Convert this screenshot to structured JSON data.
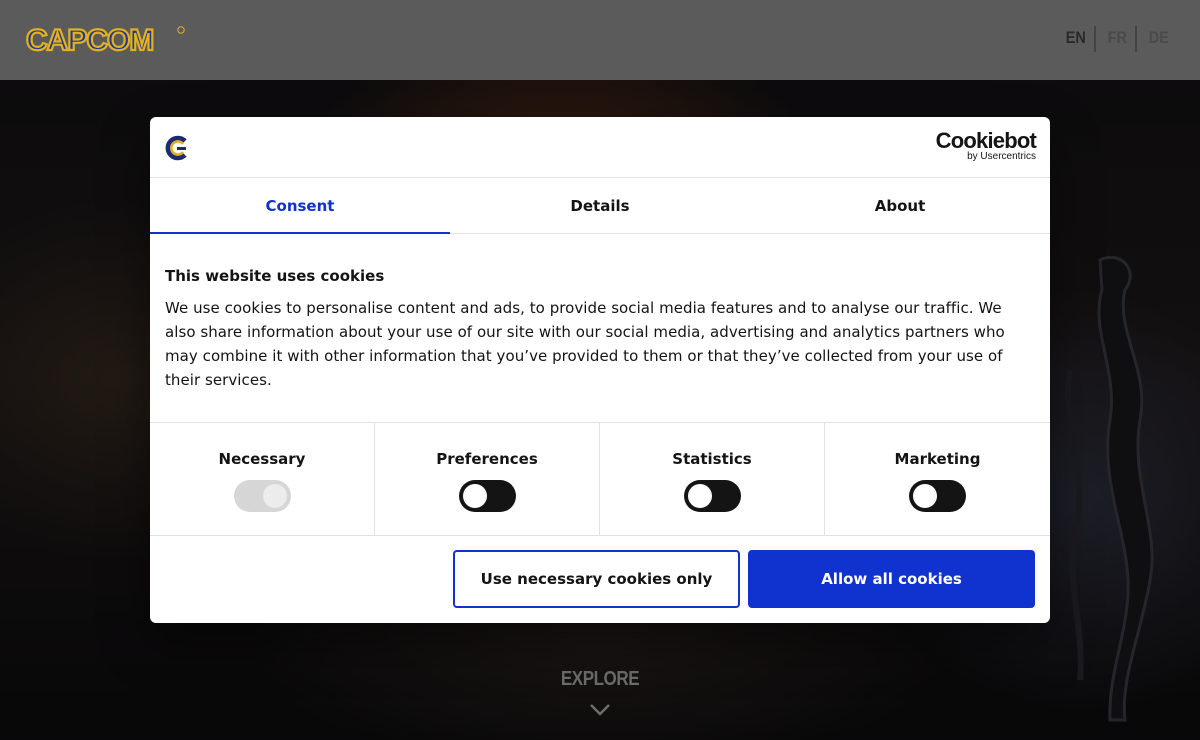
{
  "header": {
    "logo_text": "CAPCOM",
    "languages": [
      {
        "code": "EN",
        "active": true
      },
      {
        "code": "FR",
        "active": false
      },
      {
        "code": "DE",
        "active": false
      }
    ]
  },
  "hero": {
    "explore_label": "EXPLORE",
    "explore_icon": "chevron-down-icon"
  },
  "cookie_dialog": {
    "brand": {
      "name": "Cookiebot",
      "byline": "by Usercentrics"
    },
    "tabs": [
      {
        "label": "Consent",
        "active": true
      },
      {
        "label": "Details",
        "active": false
      },
      {
        "label": "About",
        "active": false
      }
    ],
    "title": "This website uses cookies",
    "description": "We use cookies to personalise content and ads, to provide social media features and to analyse our traffic. We also share information about your use of our site with our social media, advertising and analytics partners who may combine it with other information that you’ve provided to them or that they’ve collected from your use of their services.",
    "categories": [
      {
        "label": "Necessary",
        "checked": true,
        "disabled": true
      },
      {
        "label": "Preferences",
        "checked": false,
        "disabled": false
      },
      {
        "label": "Statistics",
        "checked": false,
        "disabled": false
      },
      {
        "label": "Marketing",
        "checked": false,
        "disabled": false
      }
    ],
    "buttons": {
      "necessary_only": "Use necessary cookies only",
      "allow_all": "Allow all cookies"
    }
  },
  "colors": {
    "accent": "#1032cf",
    "header_bg": "#5b5b5b",
    "toggle_off": "#141414",
    "toggle_disabled": "#d6d6d6"
  }
}
